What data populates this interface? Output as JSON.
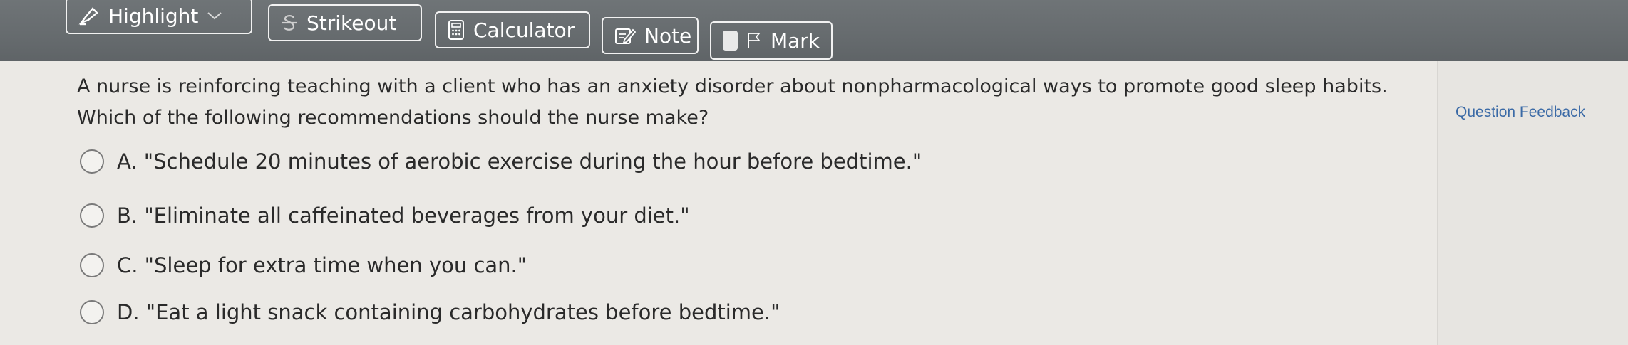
{
  "toolbar": {
    "highlight_label": "Highlight",
    "strikeout_label": "Strikeout",
    "calculator_label": "Calculator",
    "note_label": "Note",
    "mark_label": "Mark"
  },
  "question": {
    "text": "A nurse is reinforcing teaching with a client who has an anxiety disorder about nonpharmacological ways to promote good sleep habits. Which of the following recommendations should the nurse make?"
  },
  "options": [
    {
      "label": "A. \"Schedule 20 minutes of aerobic exercise during the hour before bedtime.\""
    },
    {
      "label": "B. \"Eliminate all caffeinated beverages from your diet.\""
    },
    {
      "label": "C. \"Sleep for extra time when you can.\""
    },
    {
      "label": "D. \"Eat a light snack containing carbohydrates before bedtime.\""
    }
  ],
  "feedback": {
    "link_label": "Question Feedback"
  },
  "colors": {
    "toolbar_bg": "#666b6e",
    "page_bg": "#ebe9e5",
    "link": "#3b6aa6"
  }
}
